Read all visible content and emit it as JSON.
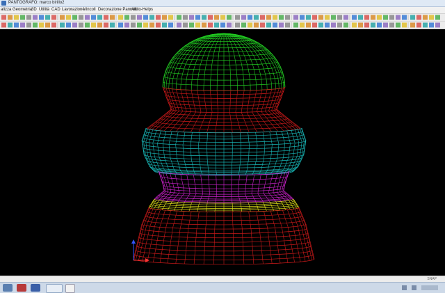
{
  "window": {
    "title": "PANTOGRAFO: marco birillo2"
  },
  "menu": {
    "items": [
      "alizza",
      "Geometria",
      "3D",
      "Utilità",
      "CAD",
      "Lavorazione",
      "Vincoli",
      "Decorazione Pannelli",
      "Aiuto-Helps"
    ]
  },
  "status": {
    "snap": "SNAP"
  },
  "colors": {
    "dome": "#22cc22",
    "neck": "#cc1a1a",
    "bulb": "#19b8b8",
    "lower": "#cc22cc",
    "band": "#e6e61a",
    "base": "#cc1a1a",
    "axis_y": "#3355ff",
    "axis_x": "#ff3333"
  },
  "icons": {
    "titlebar": "app-icon",
    "axes": "axis-triad-icon"
  }
}
